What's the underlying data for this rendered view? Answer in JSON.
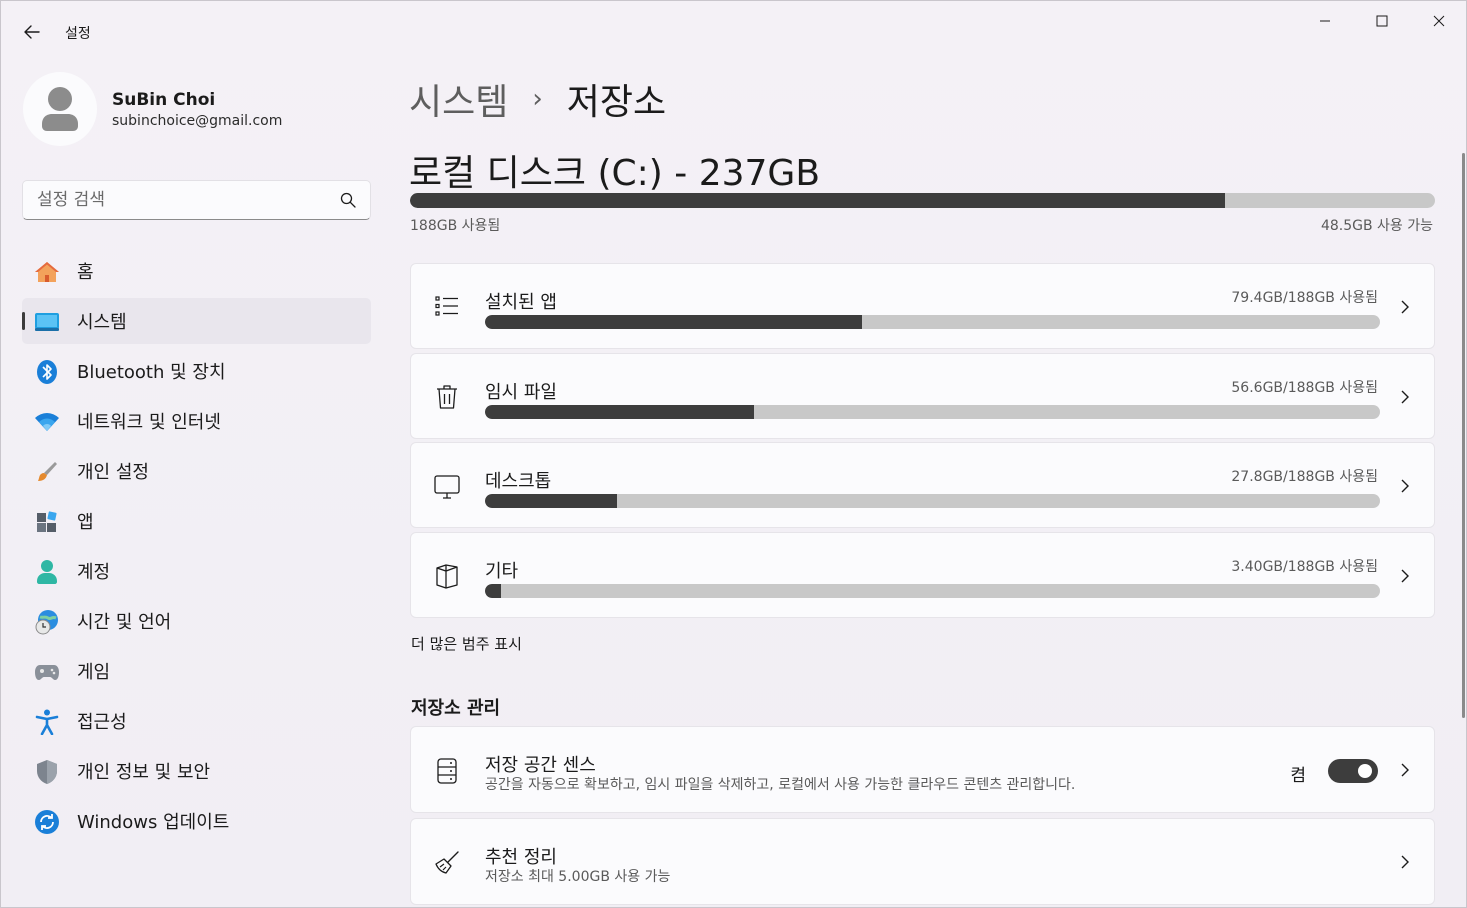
{
  "window": {
    "title": "설정"
  },
  "profile": {
    "name": "SuBin Choi",
    "email": "subinchoice@gmail.com"
  },
  "search": {
    "placeholder": "설정 검색"
  },
  "nav": {
    "items": [
      {
        "label": "홈",
        "icon": "home-icon"
      },
      {
        "label": "시스템",
        "icon": "system-icon",
        "active": true
      },
      {
        "label": "Bluetooth 및 장치",
        "icon": "bluetooth-icon"
      },
      {
        "label": "네트워크 및 인터넷",
        "icon": "wifi-icon"
      },
      {
        "label": "개인 설정",
        "icon": "brush-icon"
      },
      {
        "label": "앱",
        "icon": "apps-icon"
      },
      {
        "label": "계정",
        "icon": "account-icon"
      },
      {
        "label": "시간 및 언어",
        "icon": "time-language-icon"
      },
      {
        "label": "게임",
        "icon": "gamepad-icon"
      },
      {
        "label": "접근성",
        "icon": "accessibility-icon"
      },
      {
        "label": "개인 정보 및 보안",
        "icon": "shield-icon"
      },
      {
        "label": "Windows 업데이트",
        "icon": "update-icon"
      }
    ]
  },
  "breadcrumb": {
    "parent": "시스템",
    "separator": "›",
    "current": "저장소"
  },
  "disk": {
    "title": "로컬 디스크 (C:) - 237GB",
    "used_label": "188GB 사용됨",
    "free_label": "48.5GB 사용 가능",
    "used_fraction": 0.795
  },
  "categories": [
    {
      "label": "설치된 앱",
      "size": "79.4GB/188GB 사용됨",
      "fraction": 0.421,
      "icon": "list-icon"
    },
    {
      "label": "임시 파일",
      "size": "56.6GB/188GB 사용됨",
      "fraction": 0.301,
      "icon": "trash-icon"
    },
    {
      "label": "데스크톱",
      "size": "27.8GB/188GB 사용됨",
      "fraction": 0.148,
      "icon": "monitor-icon"
    },
    {
      "label": "기타",
      "size": "3.40GB/188GB 사용됨",
      "fraction": 0.018,
      "icon": "other-icon"
    }
  ],
  "more_categories": "더 많은 범주 표시",
  "management": {
    "heading": "저장소 관리",
    "storage_sense": {
      "title": "저장 공간 센스",
      "description": "공간을 자동으로 확보하고, 임시 파일을 삭제하고, 로컬에서 사용 가능한 클라우드 콘텐츠 관리합니다.",
      "toggle_state": "켬",
      "enabled": true
    },
    "cleanup": {
      "title": "추천 정리",
      "description": "저장소 최대 5.00GB 사용 가능"
    }
  },
  "colors": {
    "accent_dark": "#3d3d3d",
    "bar_track": "#c8c8c8",
    "card_bg": "#fbfbfd",
    "window_bg": "#f3f0f5"
  }
}
